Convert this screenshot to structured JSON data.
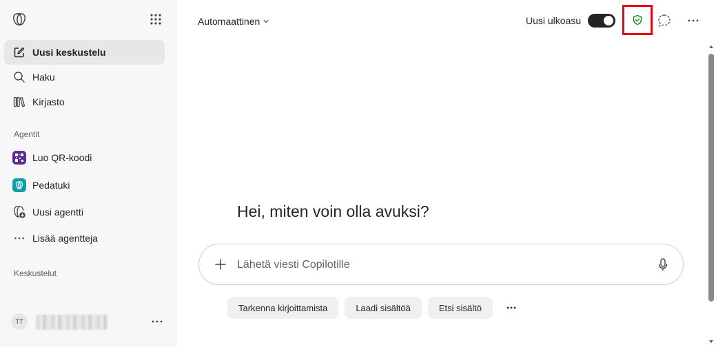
{
  "sidebar": {
    "nav": [
      {
        "label": "Uusi keskustelu",
        "icon": "new-chat-icon"
      },
      {
        "label": "Haku",
        "icon": "search-icon"
      },
      {
        "label": "Kirjasto",
        "icon": "library-icon"
      }
    ],
    "agents_heading": "Agentit",
    "agents": [
      {
        "label": "Luo QR-koodi",
        "icon": "qr-code-icon",
        "color": "#5b2d90"
      },
      {
        "label": "Pedatuki",
        "icon": "copilot-agent-icon",
        "color": "#0f9fa8"
      },
      {
        "label": "Uusi agentti",
        "icon": "new-agent-icon"
      },
      {
        "label": "Lisää agentteja",
        "icon": "more-horizontal-icon"
      }
    ],
    "chats_heading": "Keskustelut",
    "user": {
      "initials": "TT"
    }
  },
  "header": {
    "model": "Automaattinen",
    "layout_toggle_label": "Uusi ulkoasu",
    "layout_toggle_on": true,
    "highlight_color": "#e30613",
    "shield_color": "#107c10"
  },
  "main": {
    "greeting": "Hei, miten voin olla avuksi?",
    "composer_placeholder": "Lähetä viesti Copilotille",
    "chips": [
      "Tarkenna kirjoittamista",
      "Laadi sisältöä",
      "Etsi sisältö"
    ]
  }
}
